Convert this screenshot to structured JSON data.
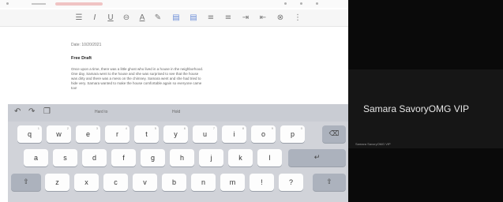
{
  "document": {
    "date": "Date: 10/20/2021",
    "title": "Free Draft",
    "lines": [
      {
        "before": "Once upon a time, there was a ",
        "highlight": "",
        "after": "",
        "full": "Once upon a time, there was a little ghost who lived in a house in the neighborhood."
      },
      {
        "full": "One day, Samara went to the house and she was surprised to see that the house"
      },
      {
        "full": "was dirty and there was a mess on the chimney. Samara went and she had tried to"
      },
      {
        "full": "hide very. Samara wanted to make the house comfortable again so everyone came"
      },
      {
        "full": "too!"
      }
    ]
  },
  "keyboard": {
    "suggestions": [
      "Hard to",
      "Hold"
    ],
    "row1": [
      "q",
      "w",
      "e",
      "r",
      "t",
      "y",
      "u",
      "i",
      "o",
      "p"
    ],
    "row1_sub": [
      "1",
      "2",
      "3",
      "4",
      "5",
      "6",
      "7",
      "8",
      "9",
      "0"
    ],
    "row2": [
      "a",
      "s",
      "d",
      "f",
      "g",
      "h",
      "j",
      "k",
      "l"
    ],
    "row3": [
      "z",
      "x",
      "c",
      "v",
      "b",
      "n",
      "m",
      "!",
      "?"
    ],
    "return_label": "↵",
    "backspace_label": "⌫",
    "shift_label": "⇧"
  },
  "video": {
    "streamer": "Samara SavoryOMG VIP",
    "subtitle": "Samara SavoryOMG VIP"
  },
  "colors": {
    "highlight": "#f7ef5c",
    "keyboard_bg": "#d1d3d9",
    "video_bg": "#0a0a0a"
  }
}
